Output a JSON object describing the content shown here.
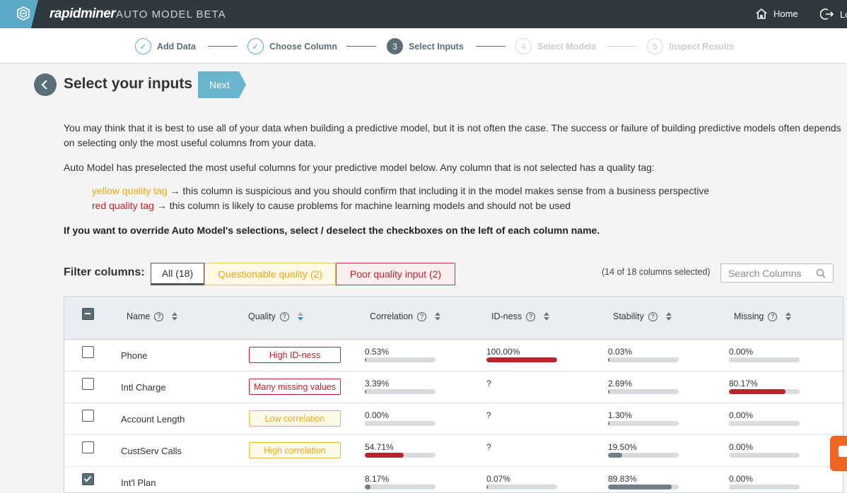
{
  "topbar": {
    "brand": "rapidminer",
    "product": "AUTO MODEL BETA",
    "home_label": "Home",
    "logout_label": "Lo"
  },
  "stepper": {
    "steps": [
      {
        "num": "✓",
        "label": "Add Data",
        "state": "done"
      },
      {
        "num": "✓",
        "label": "Choose Column",
        "state": "done"
      },
      {
        "num": "3",
        "label": "Select Inputs",
        "state": "active"
      },
      {
        "num": "4",
        "label": "Select Models",
        "state": "todo"
      },
      {
        "num": "5",
        "label": "Inspect Results",
        "state": "todo"
      }
    ]
  },
  "page": {
    "title": "Select your inputs",
    "next_label": "Next",
    "para1": "You may think that it is best to use all of your data when building a predictive model, but it is not often the case. The success or failure of building predictive models often depends on selecting only the most useful columns from your data.",
    "para2": "Auto Model has preselected the most useful columns for your predictive model below. Any column that is not selected has a quality tag:",
    "yellow_tag": "yellow quality tag",
    "yellow_desc": " → this column is suspicious and you should confirm that including it in the model makes sense from a business perspective",
    "red_tag": "red quality tag",
    "red_desc": " → this column is likely to cause problems for machine learning models and should not be used",
    "override_note": "If you want to override Auto Model's selections, select / deselect the checkboxes on the left of each column name."
  },
  "filter": {
    "label": "Filter columns:",
    "all": "All (18)",
    "questionable": "Questionable quality (2)",
    "poor": "Poor quality input (2)",
    "selected_count": "(14 of 18 columns selected)",
    "search_placeholder": "Search Columns"
  },
  "table": {
    "headers": {
      "name": "Name",
      "quality": "Quality",
      "correlation": "Correlation",
      "idness": "ID-ness",
      "stability": "Stability",
      "missing": "Missing"
    },
    "rows": [
      {
        "name": "Phone",
        "checked": false,
        "quality": "High ID-ness",
        "quality_level": "red",
        "correlation": "0.53%",
        "corr_pct": 0.53,
        "corr_color": "gray",
        "idness": "100.00%",
        "id_pct": 100,
        "id_color": "red",
        "stability": "0.03%",
        "stab_pct": 0.03,
        "stab_color": "gray",
        "missing": "0.00%",
        "miss_pct": 0,
        "miss_color": "gray"
      },
      {
        "name": "Intl Charge",
        "checked": false,
        "quality": "Many missing values",
        "quality_level": "red",
        "correlation": "3.39%",
        "corr_pct": 3.39,
        "corr_color": "gray",
        "idness": "?",
        "id_pct": 0,
        "id_color": "none",
        "stability": "2.69%",
        "stab_pct": 2.69,
        "stab_color": "gray",
        "missing": "80.17%",
        "miss_pct": 80.17,
        "miss_color": "red"
      },
      {
        "name": "Account Length",
        "checked": false,
        "quality": "Low correlation",
        "quality_level": "yellow",
        "correlation": "0.00%",
        "corr_pct": 0,
        "corr_color": "gray",
        "idness": "?",
        "id_pct": 0,
        "id_color": "none",
        "stability": "1.30%",
        "stab_pct": 1.3,
        "stab_color": "gray",
        "missing": "0.00%",
        "miss_pct": 0,
        "miss_color": "gray"
      },
      {
        "name": "CustServ Calls",
        "checked": false,
        "quality": "High correlation",
        "quality_level": "yellow",
        "correlation": "54.71%",
        "corr_pct": 54.71,
        "corr_color": "red",
        "idness": "?",
        "id_pct": 0,
        "id_color": "none",
        "stability": "19.50%",
        "stab_pct": 19.5,
        "stab_color": "gray",
        "missing": "0.00%",
        "miss_pct": 0,
        "miss_color": "gray"
      },
      {
        "name": "Int'l Plan",
        "checked": true,
        "quality": "",
        "quality_level": "none",
        "correlation": "8.17%",
        "corr_pct": 8.17,
        "corr_color": "gray",
        "idness": "0.07%",
        "id_pct": 0.07,
        "id_color": "gray",
        "stability": "89.83%",
        "stab_pct": 89.83,
        "stab_color": "gray",
        "missing": "0.00%",
        "miss_pct": 0,
        "miss_color": "gray"
      }
    ]
  }
}
